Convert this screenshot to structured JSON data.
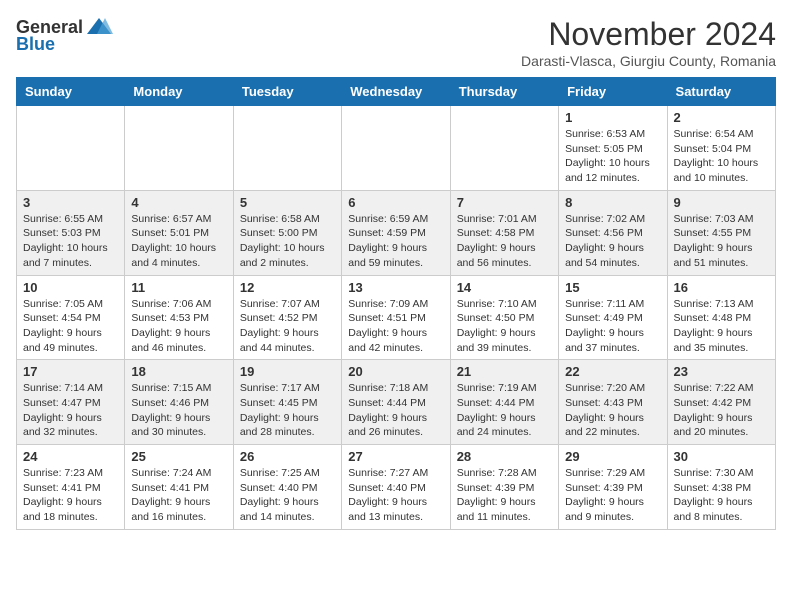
{
  "header": {
    "logo": {
      "general": "General",
      "blue": "Blue"
    },
    "title": "November 2024",
    "location": "Darasti-Vlasca, Giurgiu County, Romania"
  },
  "calendar": {
    "days_of_week": [
      "Sunday",
      "Monday",
      "Tuesday",
      "Wednesday",
      "Thursday",
      "Friday",
      "Saturday"
    ],
    "weeks": [
      [
        {
          "day": "",
          "info": ""
        },
        {
          "day": "",
          "info": ""
        },
        {
          "day": "",
          "info": ""
        },
        {
          "day": "",
          "info": ""
        },
        {
          "day": "",
          "info": ""
        },
        {
          "day": "1",
          "info": "Sunrise: 6:53 AM\nSunset: 5:05 PM\nDaylight: 10 hours and 12 minutes."
        },
        {
          "day": "2",
          "info": "Sunrise: 6:54 AM\nSunset: 5:04 PM\nDaylight: 10 hours and 10 minutes."
        }
      ],
      [
        {
          "day": "3",
          "info": "Sunrise: 6:55 AM\nSunset: 5:03 PM\nDaylight: 10 hours and 7 minutes."
        },
        {
          "day": "4",
          "info": "Sunrise: 6:57 AM\nSunset: 5:01 PM\nDaylight: 10 hours and 4 minutes."
        },
        {
          "day": "5",
          "info": "Sunrise: 6:58 AM\nSunset: 5:00 PM\nDaylight: 10 hours and 2 minutes."
        },
        {
          "day": "6",
          "info": "Sunrise: 6:59 AM\nSunset: 4:59 PM\nDaylight: 9 hours and 59 minutes."
        },
        {
          "day": "7",
          "info": "Sunrise: 7:01 AM\nSunset: 4:58 PM\nDaylight: 9 hours and 56 minutes."
        },
        {
          "day": "8",
          "info": "Sunrise: 7:02 AM\nSunset: 4:56 PM\nDaylight: 9 hours and 54 minutes."
        },
        {
          "day": "9",
          "info": "Sunrise: 7:03 AM\nSunset: 4:55 PM\nDaylight: 9 hours and 51 minutes."
        }
      ],
      [
        {
          "day": "10",
          "info": "Sunrise: 7:05 AM\nSunset: 4:54 PM\nDaylight: 9 hours and 49 minutes."
        },
        {
          "day": "11",
          "info": "Sunrise: 7:06 AM\nSunset: 4:53 PM\nDaylight: 9 hours and 46 minutes."
        },
        {
          "day": "12",
          "info": "Sunrise: 7:07 AM\nSunset: 4:52 PM\nDaylight: 9 hours and 44 minutes."
        },
        {
          "day": "13",
          "info": "Sunrise: 7:09 AM\nSunset: 4:51 PM\nDaylight: 9 hours and 42 minutes."
        },
        {
          "day": "14",
          "info": "Sunrise: 7:10 AM\nSunset: 4:50 PM\nDaylight: 9 hours and 39 minutes."
        },
        {
          "day": "15",
          "info": "Sunrise: 7:11 AM\nSunset: 4:49 PM\nDaylight: 9 hours and 37 minutes."
        },
        {
          "day": "16",
          "info": "Sunrise: 7:13 AM\nSunset: 4:48 PM\nDaylight: 9 hours and 35 minutes."
        }
      ],
      [
        {
          "day": "17",
          "info": "Sunrise: 7:14 AM\nSunset: 4:47 PM\nDaylight: 9 hours and 32 minutes."
        },
        {
          "day": "18",
          "info": "Sunrise: 7:15 AM\nSunset: 4:46 PM\nDaylight: 9 hours and 30 minutes."
        },
        {
          "day": "19",
          "info": "Sunrise: 7:17 AM\nSunset: 4:45 PM\nDaylight: 9 hours and 28 minutes."
        },
        {
          "day": "20",
          "info": "Sunrise: 7:18 AM\nSunset: 4:44 PM\nDaylight: 9 hours and 26 minutes."
        },
        {
          "day": "21",
          "info": "Sunrise: 7:19 AM\nSunset: 4:44 PM\nDaylight: 9 hours and 24 minutes."
        },
        {
          "day": "22",
          "info": "Sunrise: 7:20 AM\nSunset: 4:43 PM\nDaylight: 9 hours and 22 minutes."
        },
        {
          "day": "23",
          "info": "Sunrise: 7:22 AM\nSunset: 4:42 PM\nDaylight: 9 hours and 20 minutes."
        }
      ],
      [
        {
          "day": "24",
          "info": "Sunrise: 7:23 AM\nSunset: 4:41 PM\nDaylight: 9 hours and 18 minutes."
        },
        {
          "day": "25",
          "info": "Sunrise: 7:24 AM\nSunset: 4:41 PM\nDaylight: 9 hours and 16 minutes."
        },
        {
          "day": "26",
          "info": "Sunrise: 7:25 AM\nSunset: 4:40 PM\nDaylight: 9 hours and 14 minutes."
        },
        {
          "day": "27",
          "info": "Sunrise: 7:27 AM\nSunset: 4:40 PM\nDaylight: 9 hours and 13 minutes."
        },
        {
          "day": "28",
          "info": "Sunrise: 7:28 AM\nSunset: 4:39 PM\nDaylight: 9 hours and 11 minutes."
        },
        {
          "day": "29",
          "info": "Sunrise: 7:29 AM\nSunset: 4:39 PM\nDaylight: 9 hours and 9 minutes."
        },
        {
          "day": "30",
          "info": "Sunrise: 7:30 AM\nSunset: 4:38 PM\nDaylight: 9 hours and 8 minutes."
        }
      ]
    ]
  }
}
